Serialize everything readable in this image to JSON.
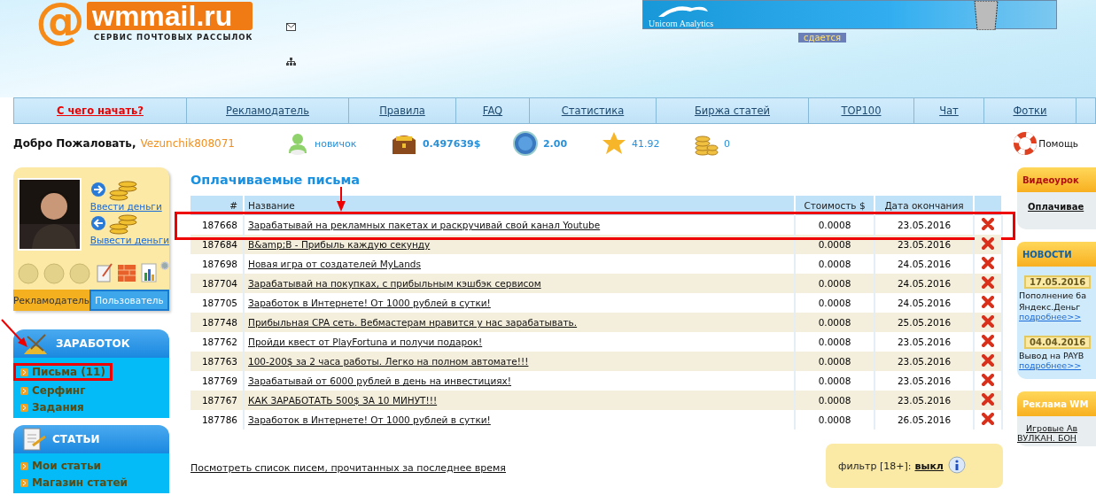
{
  "header": {
    "logo_mark": "@",
    "logo": "wmmail.ru",
    "tagline": "СЕРВИС ПОЧТОВЫХ РАССЫЛОК",
    "banner_text": "Unicorn Analytics",
    "banner_tag": "сдается"
  },
  "nav": [
    {
      "label": "С чего начать?",
      "accent": true
    },
    {
      "label": "Рекламодатель",
      "accent": false
    },
    {
      "label": "Правила",
      "accent": false
    },
    {
      "label": "FAQ",
      "accent": false
    },
    {
      "label": "Статистика",
      "accent": false
    },
    {
      "label": "Биржа статей",
      "accent": false
    },
    {
      "label": "TOP100",
      "accent": false
    },
    {
      "label": "Чат",
      "accent": false
    },
    {
      "label": "Фотки",
      "accent": false
    }
  ],
  "welcome": {
    "greeting": "Добро Пожаловать,",
    "username": "Vezunchik808071"
  },
  "stats": [
    {
      "kind": "rank",
      "value": "новичок"
    },
    {
      "kind": "balance",
      "value": "0.497639$"
    },
    {
      "kind": "credit",
      "value": "2.00"
    },
    {
      "kind": "rating",
      "value": "41.92"
    },
    {
      "kind": "coins",
      "value": "0"
    }
  ],
  "help": "Помощь",
  "profile": {
    "deposit": "Ввести деньги",
    "withdraw": "Вывести деньги",
    "tabs": [
      {
        "label": "Рекламодатель",
        "selected": false
      },
      {
        "label": "Пользователь",
        "selected": true
      }
    ]
  },
  "menu": [
    {
      "title": "ЗАРАБОТОК",
      "items": [
        {
          "label": "Письма (11)",
          "marked": true
        },
        {
          "label": "Серфинг",
          "marked": false
        },
        {
          "label": "Задания",
          "marked": false
        }
      ]
    },
    {
      "title": "СТАТЬИ",
      "items": [
        {
          "label": "Мои статьи",
          "marked": false
        },
        {
          "label": "Магазин статей",
          "marked": false
        }
      ]
    }
  ],
  "main": {
    "title": "Оплачиваемые письма",
    "columns": [
      "#",
      "Название",
      "Стоимость $",
      "Дата окончания"
    ],
    "rows": [
      {
        "id": "187668",
        "name": "Зарабатывай на рекламных пакетах и раскручивай свой канал Youtube",
        "cost": "0.0008",
        "end": "23.05.2016",
        "marked": true
      },
      {
        "id": "187684",
        "name": "B&amp;B - Прибыль каждую секунду",
        "cost": "0.0008",
        "end": "23.05.2016",
        "marked": false
      },
      {
        "id": "187698",
        "name": "Новая игра от создателей MyLands",
        "cost": "0.0008",
        "end": "24.05.2016",
        "marked": false
      },
      {
        "id": "187704",
        "name": "Зарабатывай на покупках, с прибыльным кэшбэк сервисом",
        "cost": "0.0008",
        "end": "24.05.2016",
        "marked": false
      },
      {
        "id": "187705",
        "name": "Заработок в Интернете! От 1000 рублей в сутки!",
        "cost": "0.0008",
        "end": "24.05.2016",
        "marked": false
      },
      {
        "id": "187748",
        "name": "Прибыльная CPA сеть. Вебмастерам нравится у нас зарабатывать.",
        "cost": "0.0008",
        "end": "25.05.2016",
        "marked": false
      },
      {
        "id": "187762",
        "name": "Пройди квест от PlayFortuna и получи подарок!",
        "cost": "0.0008",
        "end": "23.05.2016",
        "marked": false
      },
      {
        "id": "187763",
        "name": "100-200$ за 2 часа работы. Легко на полном автомате!!!",
        "cost": "0.0008",
        "end": "23.05.2016",
        "marked": false
      },
      {
        "id": "187769",
        "name": "Зарабатывай от 6000 рублей в день на инвестициях!",
        "cost": "0.0008",
        "end": "23.05.2016",
        "marked": false
      },
      {
        "id": "187767",
        "name": "КАК ЗАРАБОТАТЬ 500$ ЗА 10 МИНУТ!!!",
        "cost": "0.0008",
        "end": "23.05.2016",
        "marked": false
      },
      {
        "id": "187786",
        "name": "Заработок в Интернете! От 1000 рублей в сутки!",
        "cost": "0.0008",
        "end": "26.05.2016",
        "marked": false
      }
    ],
    "history_link": "Посмотреть список писем, прочитанных за последнее время",
    "filter_label": "фильтр [18+]:",
    "filter_value": "выкл"
  },
  "right": {
    "video": {
      "title": "Видеоурок",
      "text": "Оплачивае"
    },
    "news": {
      "title": "НОВОСТИ",
      "items": [
        {
          "date": "17.05.2016",
          "lines": [
            "Пополнение ба",
            "Яндекс.Деньг"
          ],
          "more": "подробнее>>"
        },
        {
          "date": "04.04.2016",
          "lines": [
            "Вывод на PAYB"
          ],
          "more": "подробнее>>"
        }
      ]
    },
    "ads": {
      "title": "Реклама WM",
      "lines": [
        "Игровые Ав",
        "ВУЛКАН. БОН"
      ]
    }
  }
}
